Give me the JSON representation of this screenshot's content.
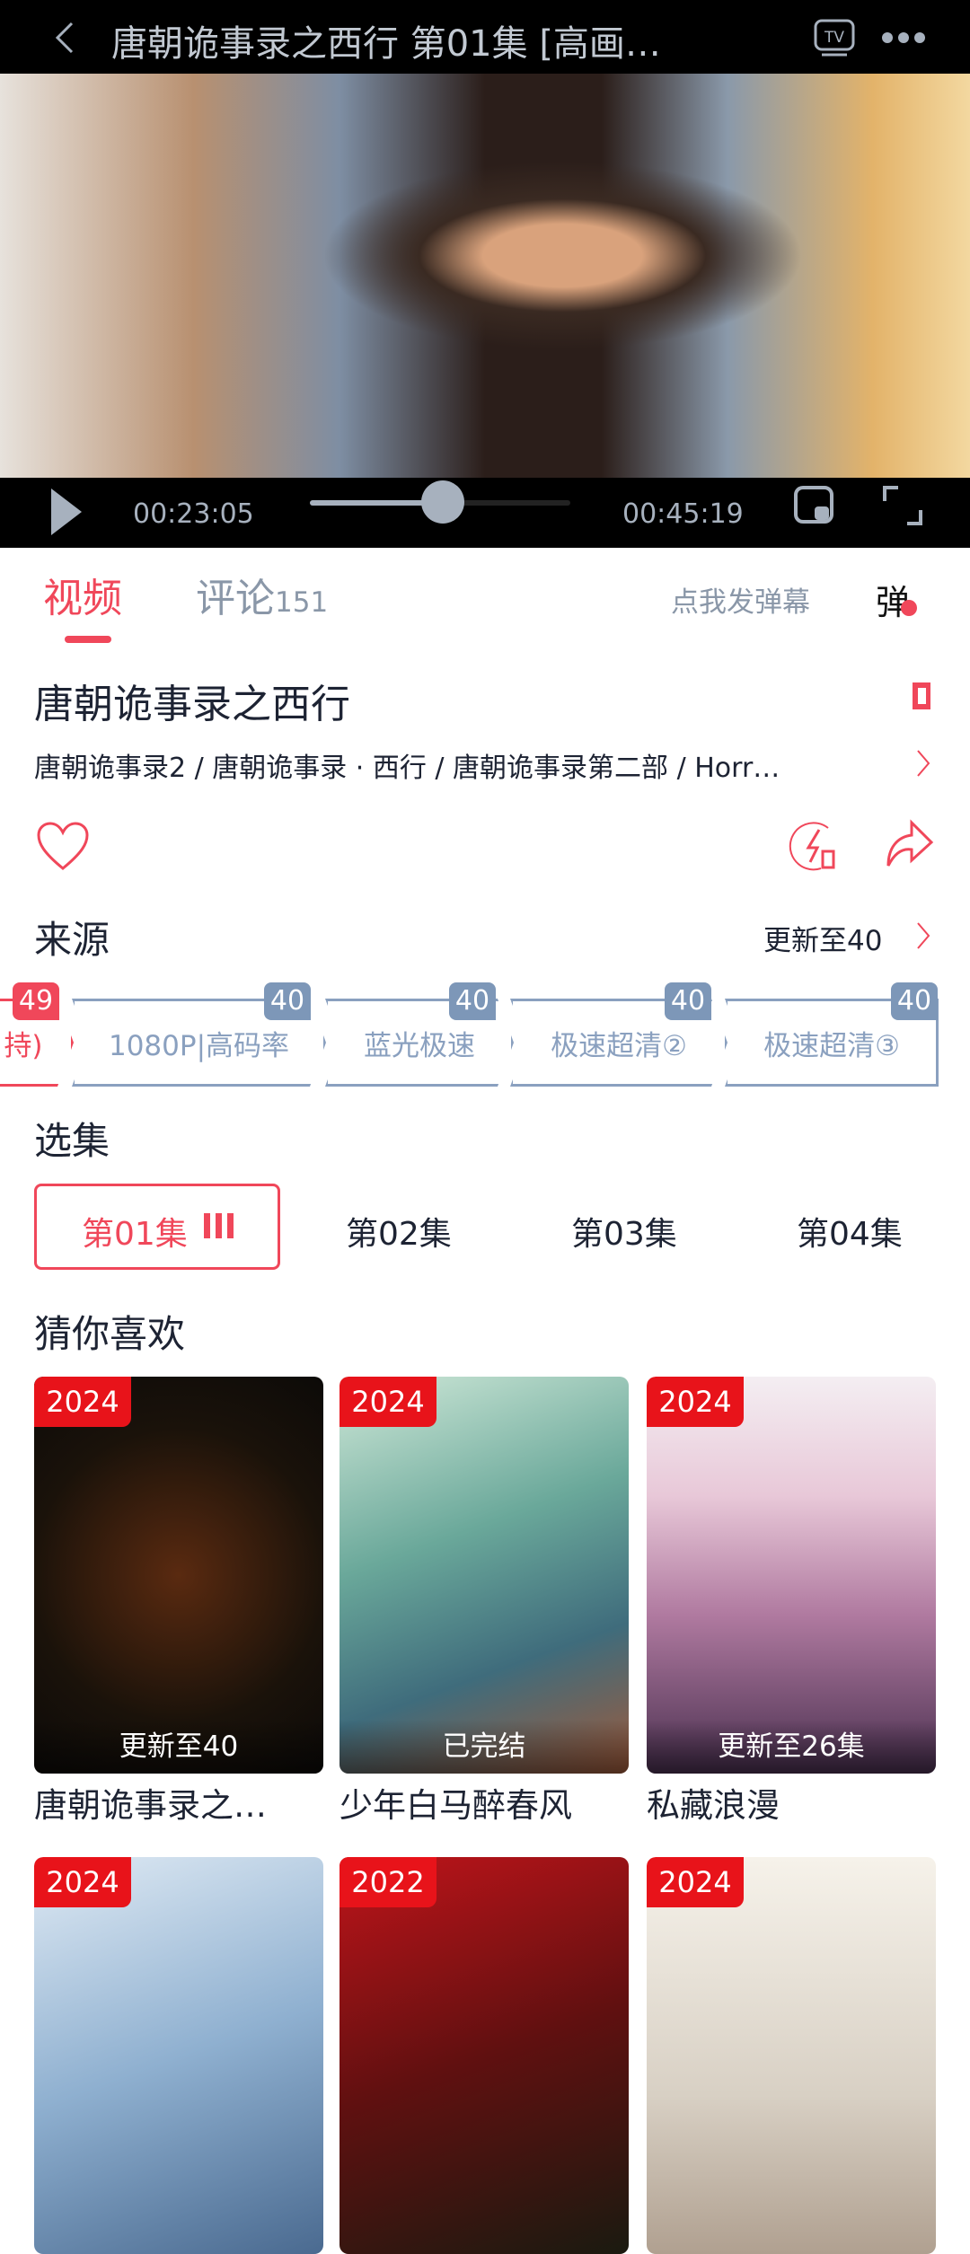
{
  "header": {
    "title": "唐朝诡事录之西行 第01集 [高画…",
    "back_icon": "chevron-left-icon",
    "tv_icon": "tv-cast-icon",
    "more_icon": "more-dots-icon"
  },
  "player": {
    "current_time": "00:23:05",
    "total_time": "00:45:19",
    "progress": 0.509
  },
  "tabs": [
    {
      "label": "视频",
      "active": true
    },
    {
      "label": "评论",
      "count": "151"
    }
  ],
  "danmaku": {
    "send_label": "点我发弹幕",
    "toggle_label": "弹"
  },
  "show": {
    "title": "唐朝诡事录之西行",
    "aliases": "唐朝诡事录2 / 唐朝诡事录 · 西行 / 唐朝诡事录第二部 / Horr…"
  },
  "source": {
    "heading": "来源",
    "update": "更新至40",
    "chips": [
      {
        "label": "持)",
        "count": "49",
        "active": true
      },
      {
        "label": "1080P|高码率",
        "count": "40"
      },
      {
        "label": "蓝光极速",
        "count": "40"
      },
      {
        "label": "极速超清②",
        "count": "40"
      },
      {
        "label": "极速超清③",
        "count": "40"
      }
    ]
  },
  "episodes": {
    "heading": "选集",
    "items": [
      "第01集",
      "第02集",
      "第03集",
      "第04集"
    ]
  },
  "recommend": {
    "heading": "猜你喜欢",
    "items": [
      {
        "year": "2024",
        "status": "更新至40",
        "title": "唐朝诡事录之…"
      },
      {
        "year": "2024",
        "status": "已完结",
        "title": "少年白马醉春风"
      },
      {
        "year": "2024",
        "status": "更新至26集",
        "title": "私藏浪漫"
      },
      {
        "year": "2024"
      },
      {
        "year": "2022"
      },
      {
        "year": "2024"
      }
    ]
  },
  "colors": {
    "accent": "#f0475a",
    "badge": "#7d97b8",
    "year_tag": "#e8131a"
  }
}
